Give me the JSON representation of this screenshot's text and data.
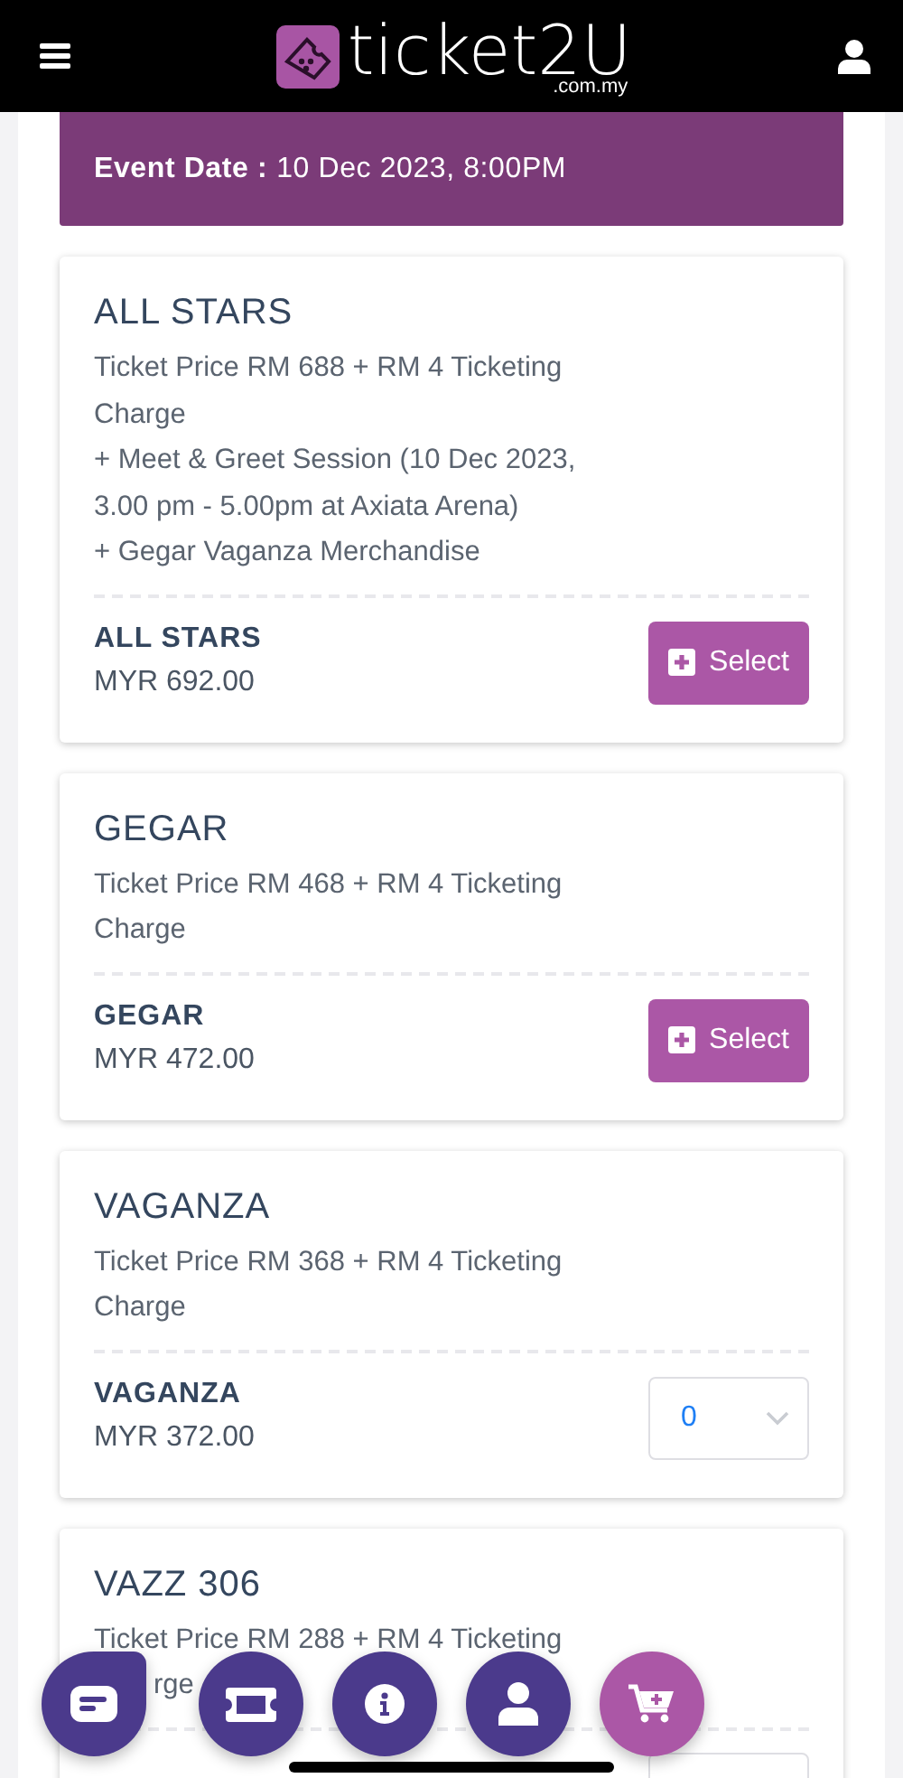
{
  "header": {
    "logo_text": "ticket2U",
    "logo_domain": ".com.my"
  },
  "event_date": {
    "label": "Event Date :",
    "value": "10 Dec 2023, 8:00PM"
  },
  "tickets": [
    {
      "title": "ALL STARS",
      "description": [
        "Ticket Price RM 688 + RM 4 Ticketing Charge",
        "+ Meet & Greet Session (10 Dec 2023, 3.00 pm - 5.00pm at Axiata Arena)",
        "+ Gegar Vaganza Merchandise"
      ],
      "name": "ALL STARS",
      "price": "MYR 692.00",
      "kind": "button",
      "button_label": "Select"
    },
    {
      "title": "GEGAR",
      "description": [
        "Ticket Price RM 468 + RM 4 Ticketing Charge"
      ],
      "name": "GEGAR",
      "price": "MYR 472.00",
      "kind": "button",
      "button_label": "Select"
    },
    {
      "title": "VAGANZA",
      "description": [
        "Ticket Price RM 368 + RM 4 Ticketing Charge"
      ],
      "name": "VAGANZA",
      "price": "MYR 372.00",
      "kind": "quantity",
      "quantity": "0"
    },
    {
      "title": "VAZZ 306",
      "description": [
        "Ticket Price RM 288 + RM 4 Ticketing"
      ],
      "description_fragment": "rge",
      "kind": "quantity"
    }
  ],
  "floating_buttons": [
    {
      "kind": "chat"
    },
    {
      "kind": "ticket"
    },
    {
      "kind": "info"
    },
    {
      "kind": "user"
    },
    {
      "kind": "cart"
    }
  ]
}
